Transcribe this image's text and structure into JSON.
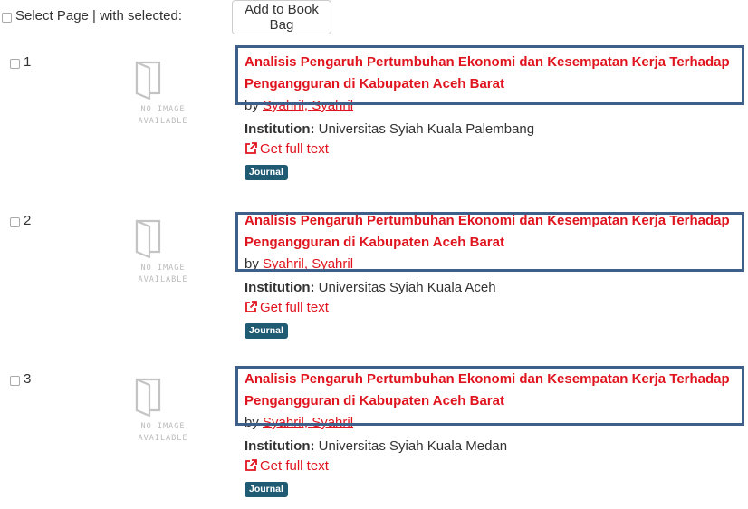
{
  "toolbar": {
    "select_label": "Select Page | with selected:",
    "add_to_book_bag": "Add to Book Bag"
  },
  "placeholder": {
    "line1": "NO IMAGE",
    "line2": "AVAILABLE"
  },
  "records": [
    {
      "number": "1",
      "title": "Analisis Pengaruh Pertumbuhan Ekonomi dan Kesempatan Kerja Terhadap Pengangguran di Kabupaten Aceh Barat",
      "by": "by",
      "author": "Syahril, Syahril",
      "institution_label": "Institution:",
      "institution": "Universitas Syiah Kuala Palembang",
      "full_text": "Get full text",
      "format": "Journal"
    },
    {
      "number": "2",
      "title": "Analisis Pengaruh Pertumbuhan Ekonomi dan Kesempatan Kerja Terhadap Pengangguran di Kabupaten Aceh Barat",
      "by": "by",
      "author": "Syahril, Syahril",
      "institution_label": "Institution:",
      "institution": "Universitas Syiah Kuala Aceh",
      "full_text": "Get full text",
      "format": "Journal"
    },
    {
      "number": "3",
      "title": "Analisis Pengaruh Pertumbuhan Ekonomi dan Kesempatan Kerja Terhadap Pengangguran di Kabupaten Aceh Barat",
      "by": "by",
      "author": "Syahril, Syahril",
      "institution_label": "Institution:",
      "institution": "Universitas Syiah Kuala Medan",
      "full_text": "Get full text",
      "format": "Journal"
    }
  ],
  "colors": {
    "link": "#e0141e",
    "badge": "#1f5b73",
    "highlight_border": "#3e5f8a"
  }
}
